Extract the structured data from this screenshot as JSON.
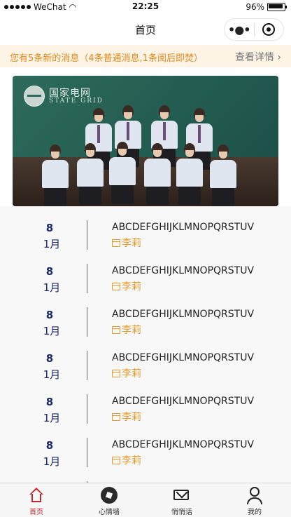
{
  "status_bar": {
    "carrier": "WeChat",
    "time": "22:25",
    "battery": "96%"
  },
  "nav": {
    "title": "首页",
    "more_icon": "more-dots-icon",
    "close_icon": "target-icon"
  },
  "notice": {
    "message": "您有5条新的消息（4条普通消息,1条阅后即焚）",
    "link": "查看详情 ›"
  },
  "banner": {
    "logo_cn": "国家电网",
    "logo_en": "STATE GRID"
  },
  "list": {
    "items": [
      {
        "day": "8",
        "month": "1月",
        "title": "ABCDEFGHIJKLMNOPQRSTUV",
        "author": "李莉"
      },
      {
        "day": "8",
        "month": "1月",
        "title": "ABCDEFGHIJKLMNOPQRSTUV",
        "author": "李莉"
      },
      {
        "day": "8",
        "month": "1月",
        "title": "ABCDEFGHIJKLMNOPQRSTUV",
        "author": "李莉"
      },
      {
        "day": "8",
        "month": "1月",
        "title": "ABCDEFGHIJKLMNOPQRSTUV",
        "author": "李莉"
      },
      {
        "day": "8",
        "month": "1月",
        "title": "ABCDEFGHIJKLMNOPQRSTUV",
        "author": "李莉"
      },
      {
        "day": "8",
        "month": "1月",
        "title": "ABCDEFGHIJKLMNOPQRSTUV",
        "author": "李莉"
      }
    ]
  },
  "tabbar": {
    "tabs": [
      {
        "label": "首页",
        "icon": "home-icon",
        "active": true
      },
      {
        "label": "心情墙",
        "icon": "aperture-icon",
        "active": false
      },
      {
        "label": "悄悄话",
        "icon": "mail-icon",
        "active": false
      },
      {
        "label": "我的",
        "icon": "user-icon",
        "active": false
      }
    ]
  },
  "colors": {
    "accent": "#c0262e",
    "notice_text": "#e08a1c",
    "date_text": "#1a2a6c",
    "author_text": "#e79a2a"
  }
}
